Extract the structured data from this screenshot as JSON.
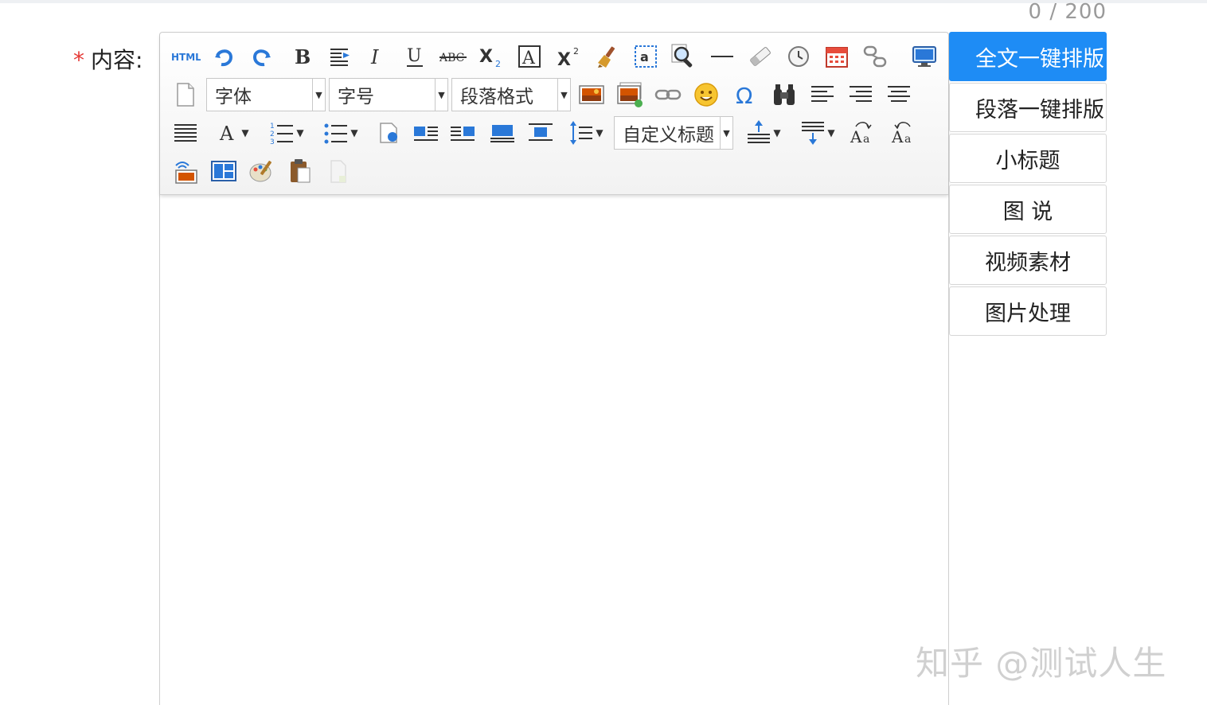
{
  "counter": "0 / 200",
  "field": {
    "required_mark": "*",
    "label": "内容:"
  },
  "toolbar": {
    "font_family": "字体",
    "font_size": "字号",
    "paragraph": "段落格式",
    "custom_title": "自定义标题"
  },
  "side_buttons": [
    "全文一键排版",
    "段落一键排版",
    "小标题",
    "图 说",
    "视频素材",
    "图片处理"
  ],
  "watermark": "知乎 @测试人生",
  "colors": {
    "primary": "#1e8cf5",
    "required": "#e53935",
    "icon_blue": "#2a78d8"
  }
}
